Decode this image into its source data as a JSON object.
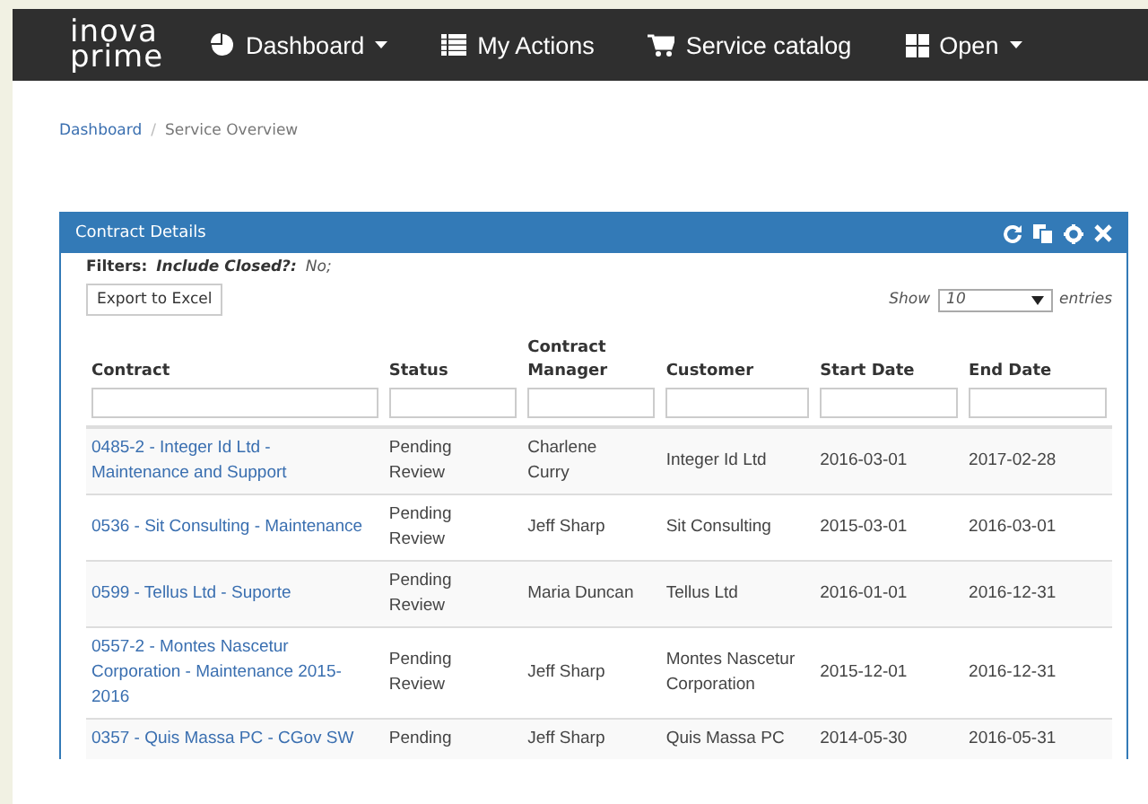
{
  "logo": {
    "line1": "inova",
    "line2": "prime"
  },
  "nav": [
    {
      "kind": "pie",
      "label": "Dashboard",
      "caret": true
    },
    {
      "kind": "list",
      "label": "My Actions",
      "caret": false
    },
    {
      "kind": "cart",
      "label": "Service catalog",
      "caret": false
    },
    {
      "kind": "grid",
      "label": "Open",
      "caret": true
    }
  ],
  "breadcrumb": {
    "link": "Dashboard",
    "separator": "/",
    "current": "Service Overview"
  },
  "panel": {
    "title": "Contract Details",
    "filters": {
      "label": "Filters:",
      "name": "Include Closed?:",
      "value": "No;"
    },
    "export_button": "Export to Excel",
    "length": {
      "before": "Show",
      "value": "10",
      "after": "entries"
    },
    "columns": [
      "Contract",
      "Status",
      "Contract Manager",
      "Customer",
      "Start Date",
      "End Date"
    ],
    "rows": [
      {
        "cells": [
          "0485-2 - Integer Id Ltd - Maintenance and Support",
          "Pending Review",
          "Charlene Curry",
          "Integer Id Ltd",
          "2016-03-01",
          "2017-02-28"
        ]
      },
      {
        "cells": [
          "0536 - Sit Consulting - Maintenance",
          "Pending Review",
          "Jeff Sharp",
          "Sit Consulting",
          "2015-03-01",
          "2016-03-01"
        ]
      },
      {
        "cells": [
          "0599 - Tellus Ltd - Suporte",
          "Pending Review",
          "Maria Duncan",
          "Tellus Ltd",
          "2016-01-01",
          "2016-12-31"
        ]
      },
      {
        "cells": [
          "0557-2 - Montes Nascetur Corporation - Maintenance 2015-2016",
          "Pending Review",
          "Jeff Sharp",
          "Montes Nascetur Corporation",
          "2015-12-01",
          "2016-12-31"
        ]
      },
      {
        "cells": [
          "0357 - Quis Massa PC - CGov SW",
          "Pending",
          "Jeff Sharp",
          "Quis Massa PC",
          "2014-05-30",
          "2016-05-31"
        ]
      }
    ]
  }
}
